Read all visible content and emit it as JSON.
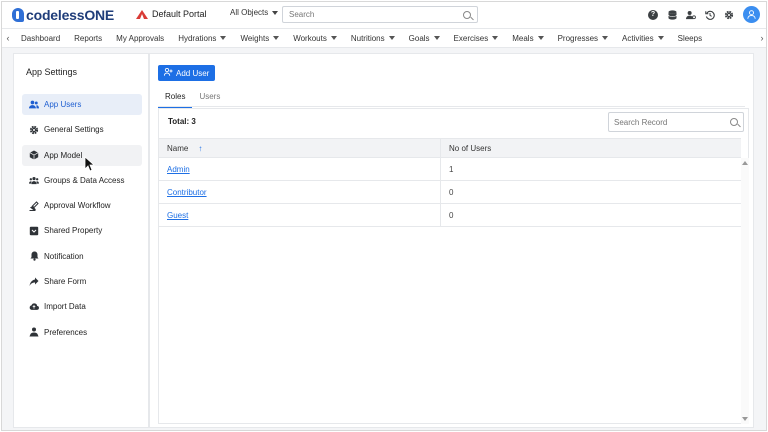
{
  "header": {
    "logo_text": "codelessONE",
    "portal_name": "Default Portal",
    "scope_label": "All Objects",
    "search_placeholder": "Search",
    "icons": [
      "help-icon",
      "database-icon",
      "user-settings-icon",
      "history-icon",
      "gear-icon",
      "user-avatar-icon"
    ]
  },
  "nav": {
    "items": [
      {
        "label": "Dashboard",
        "dropdown": false
      },
      {
        "label": "Reports",
        "dropdown": false
      },
      {
        "label": "My Approvals",
        "dropdown": false
      },
      {
        "label": "Hydrations",
        "dropdown": true
      },
      {
        "label": "Weights",
        "dropdown": true
      },
      {
        "label": "Workouts",
        "dropdown": true
      },
      {
        "label": "Nutritions",
        "dropdown": true
      },
      {
        "label": "Goals",
        "dropdown": true
      },
      {
        "label": "Exercises",
        "dropdown": true
      },
      {
        "label": "Meals",
        "dropdown": true
      },
      {
        "label": "Progresses",
        "dropdown": true
      },
      {
        "label": "Activities",
        "dropdown": true
      },
      {
        "label": "Sleeps",
        "dropdown": false
      }
    ]
  },
  "sidebar": {
    "title": "App Settings",
    "items": [
      {
        "label": "App Users",
        "icon": "users-icon"
      },
      {
        "label": "General Settings",
        "icon": "gear-icon"
      },
      {
        "label": "App Model",
        "icon": "cube-icon"
      },
      {
        "label": "Groups & Data Access",
        "icon": "group-icon"
      },
      {
        "label": "Approval Workflow",
        "icon": "workflow-icon"
      },
      {
        "label": "Shared Property",
        "icon": "shared-property-icon"
      },
      {
        "label": "Notification",
        "icon": "bell-icon"
      },
      {
        "label": "Share Form",
        "icon": "share-icon"
      },
      {
        "label": "Import Data",
        "icon": "cloud-upload-icon"
      },
      {
        "label": "Preferences",
        "icon": "preferences-icon"
      }
    ]
  },
  "main": {
    "add_button_label": "Add User",
    "tabs": [
      {
        "label": "Roles"
      },
      {
        "label": "Users"
      }
    ],
    "total_label": "Total: 3",
    "record_search_placeholder": "Search Record",
    "table": {
      "columns": [
        "Name",
        "No of Users"
      ],
      "rows": [
        {
          "name": "Admin",
          "count": "1"
        },
        {
          "name": "Contributor",
          "count": "0"
        },
        {
          "name": "Guest",
          "count": "0"
        }
      ]
    }
  },
  "colors": {
    "accent": "#1d6fe5",
    "logo": "#1f3d7a",
    "portal_icon": "#d93b36",
    "active_sidebar_bg": "#e8eef8"
  }
}
